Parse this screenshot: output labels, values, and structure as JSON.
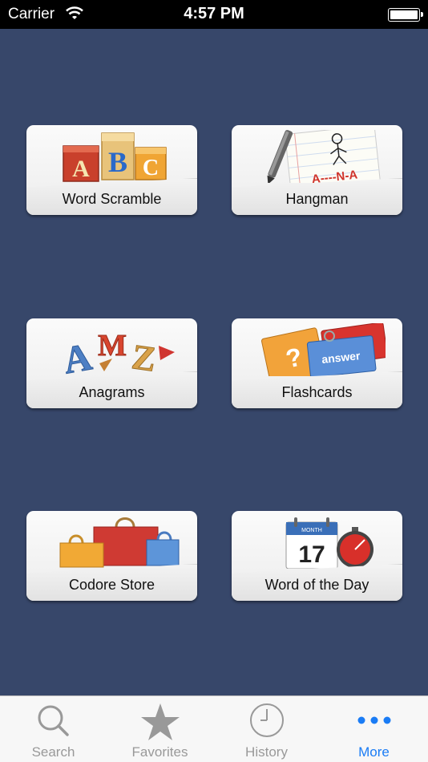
{
  "status_bar": {
    "carrier": "Carrier",
    "time": "4:57 PM"
  },
  "tiles": [
    {
      "label": "Word Scramble",
      "icon": "abc-blocks-icon"
    },
    {
      "label": "Hangman",
      "icon": "hangman-paper-icon",
      "art_text": "A----N-A"
    },
    {
      "label": "Anagrams",
      "icon": "amz-letters-icon",
      "art_text": "AMZ"
    },
    {
      "label": "Flashcards",
      "icon": "flashcards-icon",
      "art_text": "answer"
    },
    {
      "label": "Codore Store",
      "icon": "shopping-bags-icon"
    },
    {
      "label": "Word of the Day",
      "icon": "calendar-stopwatch-icon",
      "art_text": "17",
      "art_month": "MONTH"
    }
  ],
  "tab_bar": {
    "active": "More",
    "active_color": "#1a7cf5",
    "inactive_color": "#999999",
    "items": [
      {
        "label": "Search",
        "icon": "search-icon"
      },
      {
        "label": "Favorites",
        "icon": "star-icon"
      },
      {
        "label": "History",
        "icon": "clock-icon"
      },
      {
        "label": "More",
        "icon": "more-dots-icon"
      }
    ]
  },
  "colors": {
    "background": "#37476a",
    "tile": "#f2f2f2"
  }
}
